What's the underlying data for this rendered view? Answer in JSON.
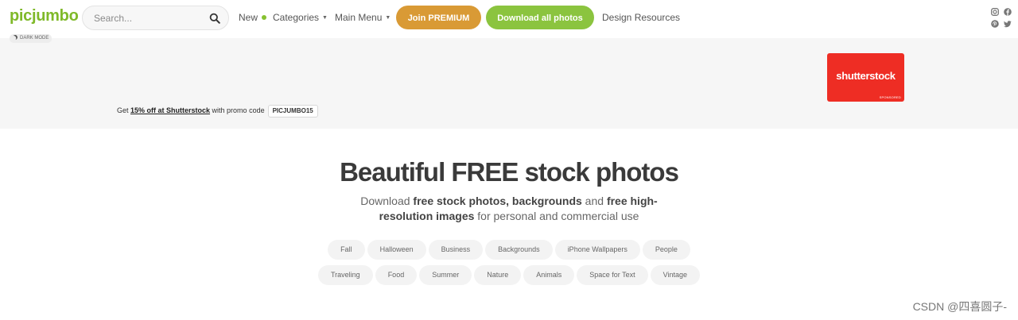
{
  "header": {
    "logo": "picjumbo",
    "search": {
      "placeholder": "Search..."
    },
    "nav": {
      "new": "New",
      "categories": "Categories",
      "main_menu": "Main Menu"
    },
    "join_premium": "Join PREMIUM",
    "download_all": "Download all photos",
    "design_resources": "Design Resources",
    "dark_mode": "DARK MODE",
    "social_icons": [
      "instagram-icon",
      "facebook-icon",
      "pinterest-icon",
      "twitter-icon"
    ]
  },
  "banner": {
    "promo_prefix": "Get ",
    "promo_link": "15% off at Shutterstock",
    "promo_suffix": " with promo code",
    "promo_code": "PICJUMBO15",
    "sponsor_name": "shutterstock",
    "sponsored_label": "SPONSORED"
  },
  "hero": {
    "title": "Beautiful FREE stock photos",
    "subtitle": {
      "t1": "Download ",
      "b1": "free stock photos, backgrounds",
      "t2": " and ",
      "b2": "free high-resolution images",
      "t3": " for personal and commercial use"
    }
  },
  "tags": {
    "row1": [
      "Fall",
      "Halloween",
      "Business",
      "Backgrounds",
      "iPhone Wallpapers",
      "People"
    ],
    "row2": [
      "Traveling",
      "Food",
      "Summer",
      "Nature",
      "Animals",
      "Space for Text",
      "Vintage"
    ]
  },
  "watermark": "CSDN @四喜圆子-",
  "colors": {
    "brand_green": "#7fb929",
    "premium": "#d99a35",
    "download": "#8bc43f",
    "shutterstock_red": "#ee2d24"
  }
}
